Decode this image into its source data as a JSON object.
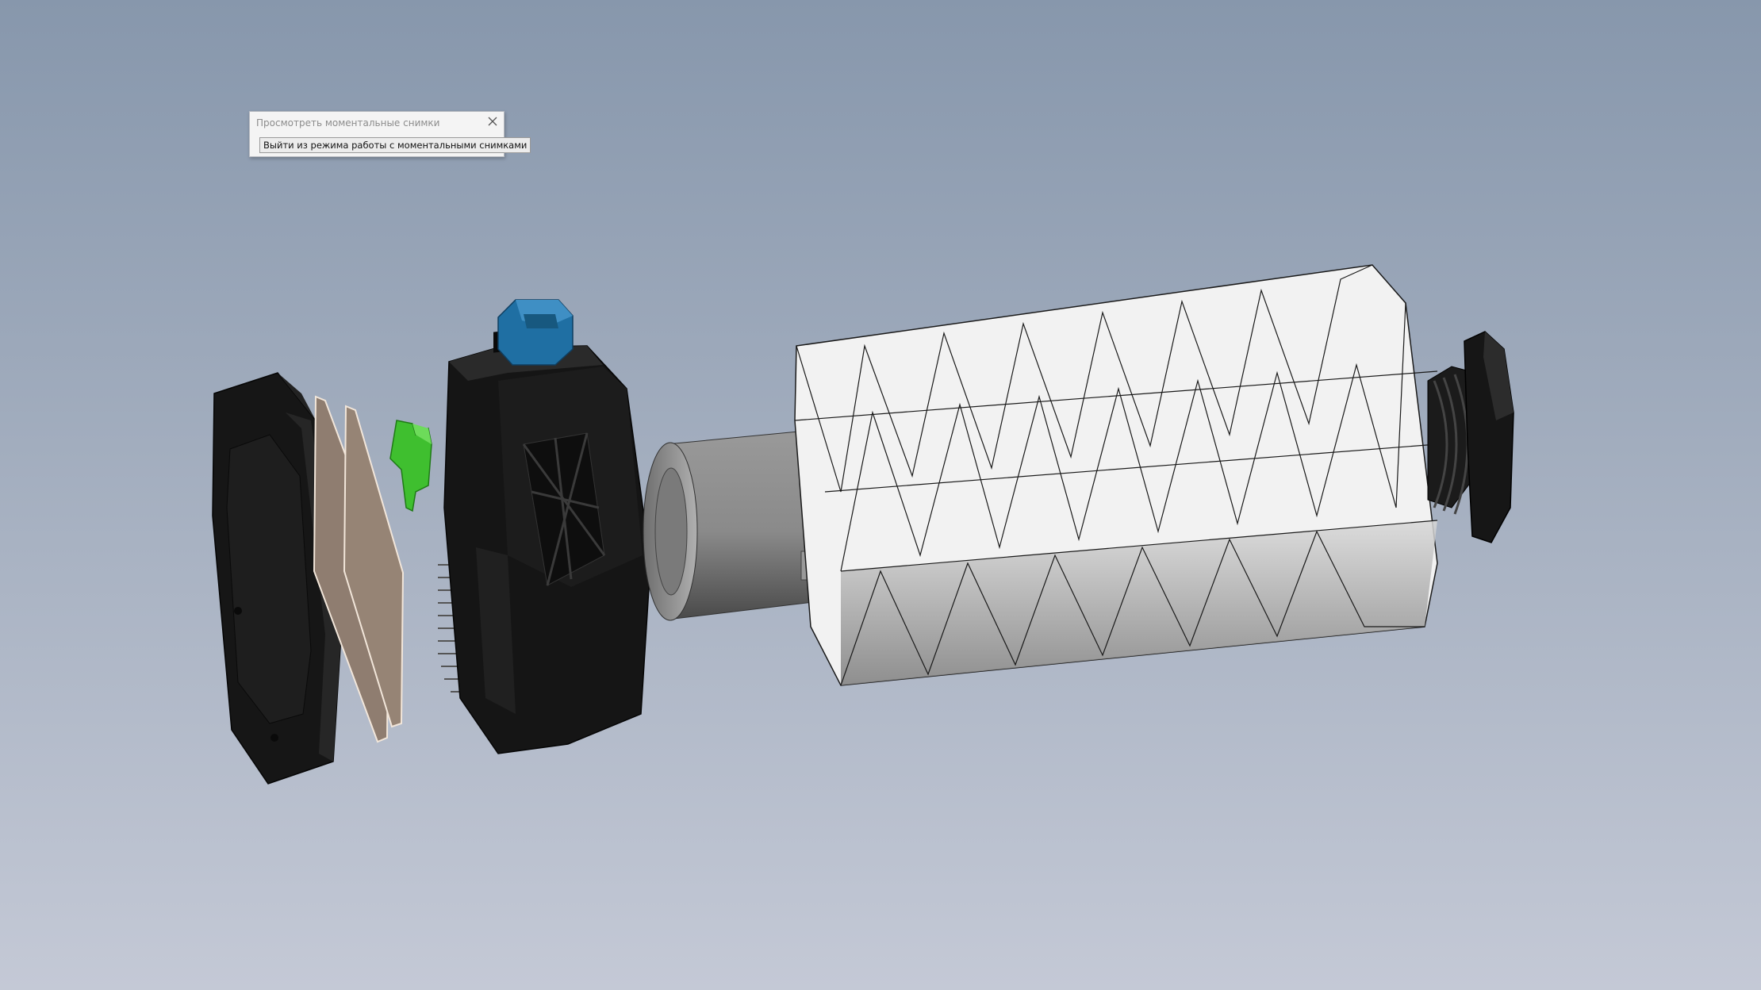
{
  "dialog": {
    "title": "Просмотреть моментальные снимки",
    "exit_button_label": "Выйти из режима работы с моментальными снимками"
  },
  "scene": {
    "background_top": "#8797ac",
    "background_bottom": "#c4c9d6",
    "parts": {
      "housing_color": "#1a1a1a",
      "switch_color": "#1f6fa3",
      "connector_color": "#3fbf2f",
      "plate_color": "#8f7d70",
      "tube_color": "#8a8a8a",
      "shell_color": "#f2f2f2"
    }
  }
}
